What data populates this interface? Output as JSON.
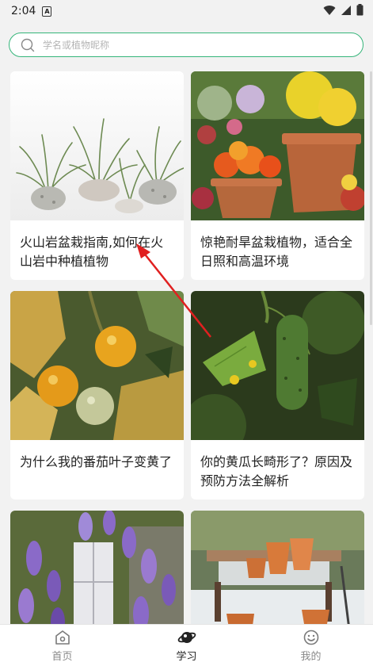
{
  "status": {
    "time": "2:04",
    "notif_icon": "A"
  },
  "search": {
    "placeholder": "学名或植物昵称"
  },
  "cards": [
    {
      "title": "火山岩盆栽指南,如何在火山岩中种植植物"
    },
    {
      "title": "惊艳耐旱盆栽植物，适合全日照和高温环境"
    },
    {
      "title": "为什么我的番茄叶子变黄了"
    },
    {
      "title": "你的黄瓜长畸形了？原因及预防方法全解析"
    }
  ],
  "tabs": [
    {
      "label": "首页",
      "icon": "home-icon",
      "active": false
    },
    {
      "label": "学习",
      "icon": "planet-icon",
      "active": true
    },
    {
      "label": "我的",
      "icon": "smiley-icon",
      "active": false
    }
  ],
  "colors": {
    "accent": "#35b57a",
    "background": "#f2f2f2",
    "annotation_arrow": "#e02020"
  }
}
